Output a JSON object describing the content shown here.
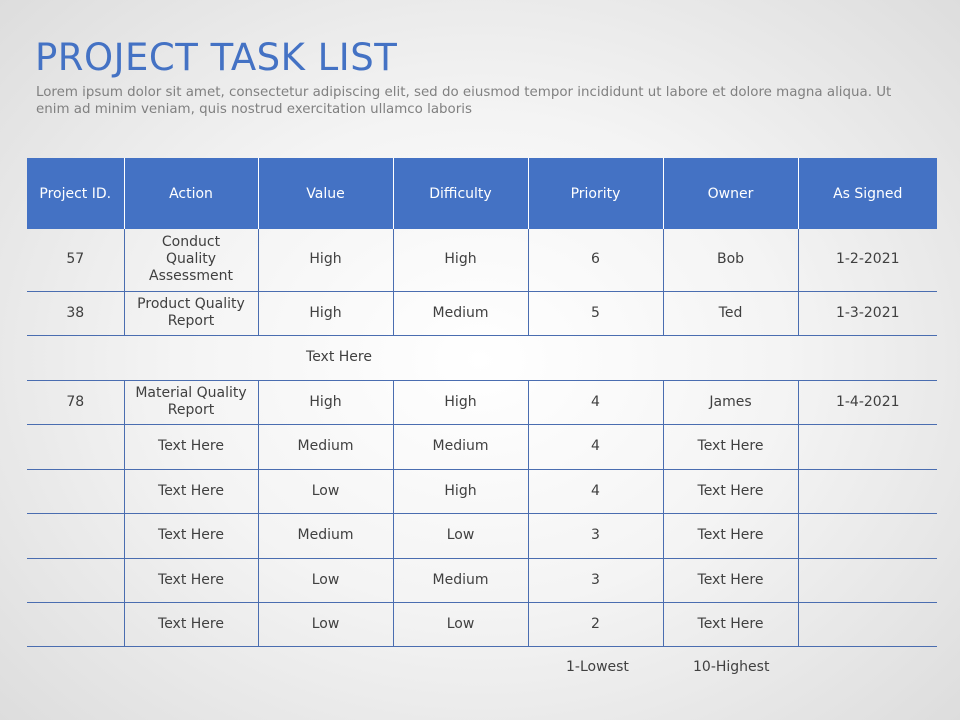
{
  "header": {
    "title": "PROJECT TASK LIST",
    "subtitle": "Lorem ipsum dolor sit amet, consectetur adipiscing  elit, sed do eiusmod tempor incididunt  ut labore et dolore magna aliqua.  Ut enim ad minim veniam, quis nostrud exercitation ullamco laboris"
  },
  "colors": {
    "accent": "#4472c4",
    "text": "#404040",
    "subtitle": "#808080"
  },
  "table": {
    "columns": [
      "Project ID.",
      "Action",
      "Value",
      "Difficulty",
      "Priority",
      "Owner",
      "As Signed"
    ],
    "rows": [
      {
        "type": "data",
        "cells": [
          "57",
          "Conduct Quality Assessment",
          "High",
          "High",
          "6",
          "Bob",
          "1-2-2021"
        ]
      },
      {
        "type": "data",
        "cells": [
          "38",
          "Product Quality Report",
          "High",
          "Medium",
          "5",
          "Ted",
          "1-3-2021"
        ]
      },
      {
        "type": "note",
        "text": "Text Here"
      },
      {
        "type": "data",
        "cells": [
          "78",
          "Material Quality Report",
          "High",
          "High",
          "4",
          "James",
          "1-4-2021"
        ]
      },
      {
        "type": "data",
        "cells": [
          "",
          "Text Here",
          "Medium",
          "Medium",
          "4",
          "Text Here",
          ""
        ]
      },
      {
        "type": "data",
        "cells": [
          "",
          "Text Here",
          "Low",
          "High",
          "4",
          "Text Here",
          ""
        ]
      },
      {
        "type": "data",
        "cells": [
          "",
          "Text Here",
          "Medium",
          "Low",
          "3",
          "Text Here",
          ""
        ]
      },
      {
        "type": "data",
        "cells": [
          "",
          "Text Here",
          "Low",
          "Medium",
          "3",
          "Text Here",
          ""
        ]
      },
      {
        "type": "data",
        "cells": [
          "",
          "Text Here",
          "Low",
          "Low",
          "2",
          "Text Here",
          ""
        ]
      }
    ]
  },
  "legend": {
    "lowest": "1-Lowest",
    "highest": "10-Highest"
  }
}
